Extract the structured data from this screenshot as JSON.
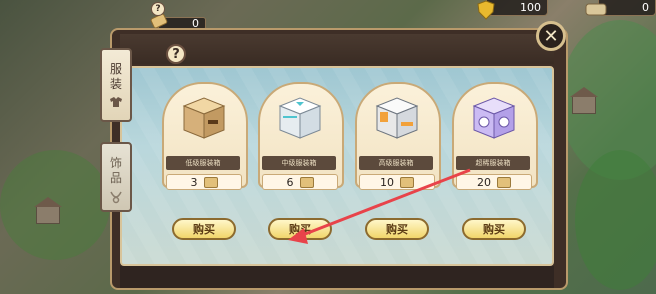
{
  "currency": {
    "ticket_amount": "0",
    "gold_amount": "100",
    "scroll_amount": "0"
  },
  "panel": {
    "help_symbol": "?",
    "close_symbol": "✕"
  },
  "side_tabs": [
    {
      "label_1": "服",
      "label_2": "装",
      "icon": "shirt-icon",
      "selected": true
    },
    {
      "label_1": "饰",
      "label_2": "品",
      "icon": "necklace-icon",
      "selected": false
    }
  ],
  "items": [
    {
      "name": "低级服装箱",
      "price": "3",
      "buy_label": "购买",
      "color": "#e8c98f"
    },
    {
      "name": "中级服装箱",
      "price": "6",
      "buy_label": "购买",
      "color": "#e9eef2"
    },
    {
      "name": "高级服装箱",
      "price": "10",
      "buy_label": "购买",
      "color": "#f0f0f0"
    },
    {
      "name": "超稀服装箱",
      "price": "20",
      "buy_label": "购买",
      "color": "#c9b8f0"
    }
  ],
  "colors": {
    "accent": "#f1d56b",
    "frame": "#3e2e26",
    "arrow": "#e8434a"
  }
}
